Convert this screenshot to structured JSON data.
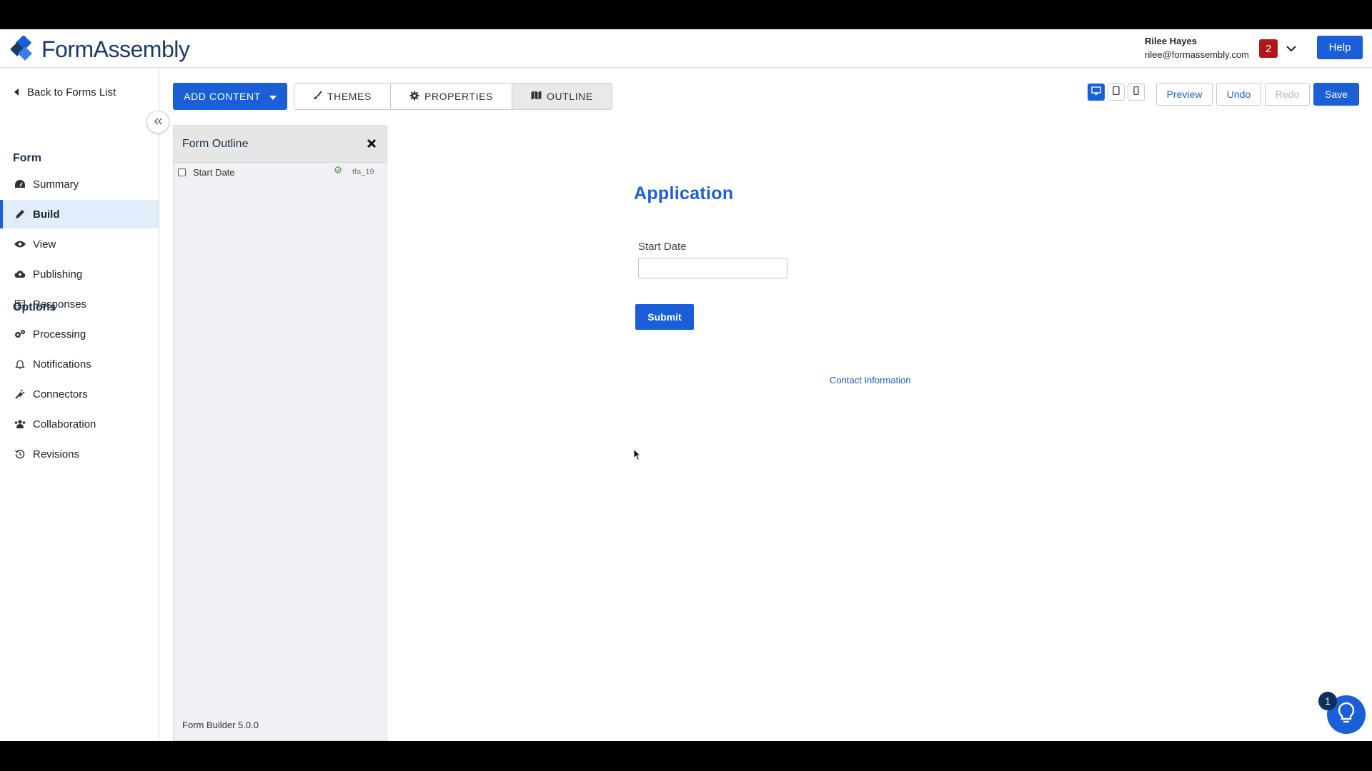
{
  "header": {
    "logo_text": "FormAssembly",
    "user_name": "Rilee Hayes",
    "user_email": "rilee@formassembly.com",
    "notification_count": "2",
    "help_label": "Help"
  },
  "sidebar": {
    "back_label": "Back to Forms List",
    "form_section": "Form",
    "form_items": [
      {
        "label": "Summary",
        "icon": "dashboard-icon"
      },
      {
        "label": "Build",
        "icon": "pencil-icon",
        "active": true
      },
      {
        "label": "View",
        "icon": "eye-icon"
      },
      {
        "label": "Publishing",
        "icon": "cloud-upload-icon"
      },
      {
        "label": "Responses",
        "icon": "table-icon"
      }
    ],
    "options_section": "Options",
    "option_items": [
      {
        "label": "Processing",
        "icon": "cogs-icon"
      },
      {
        "label": "Notifications",
        "icon": "bell-icon"
      },
      {
        "label": "Connectors",
        "icon": "plug-icon"
      },
      {
        "label": "Collaboration",
        "icon": "users-icon"
      },
      {
        "label": "Revisions",
        "icon": "history-icon"
      }
    ]
  },
  "toolbar": {
    "add_content": "ADD CONTENT",
    "tabs": [
      "THEMES",
      "PROPERTIES",
      "OUTLINE"
    ],
    "preview": "Preview",
    "undo": "Undo",
    "redo": "Redo",
    "save": "Save"
  },
  "outline": {
    "title": "Form Outline",
    "rows": [
      {
        "label": "Start Date",
        "id": "tfa_19"
      }
    ],
    "version": "Form Builder 5.0.0"
  },
  "form": {
    "title": "Application",
    "field_label": "Start Date",
    "submit": "Submit",
    "contact_link": "Contact Information"
  },
  "assistant": {
    "badge": "1"
  },
  "colors": {
    "accent": "#1a5fd8",
    "badge": "#b01818"
  }
}
